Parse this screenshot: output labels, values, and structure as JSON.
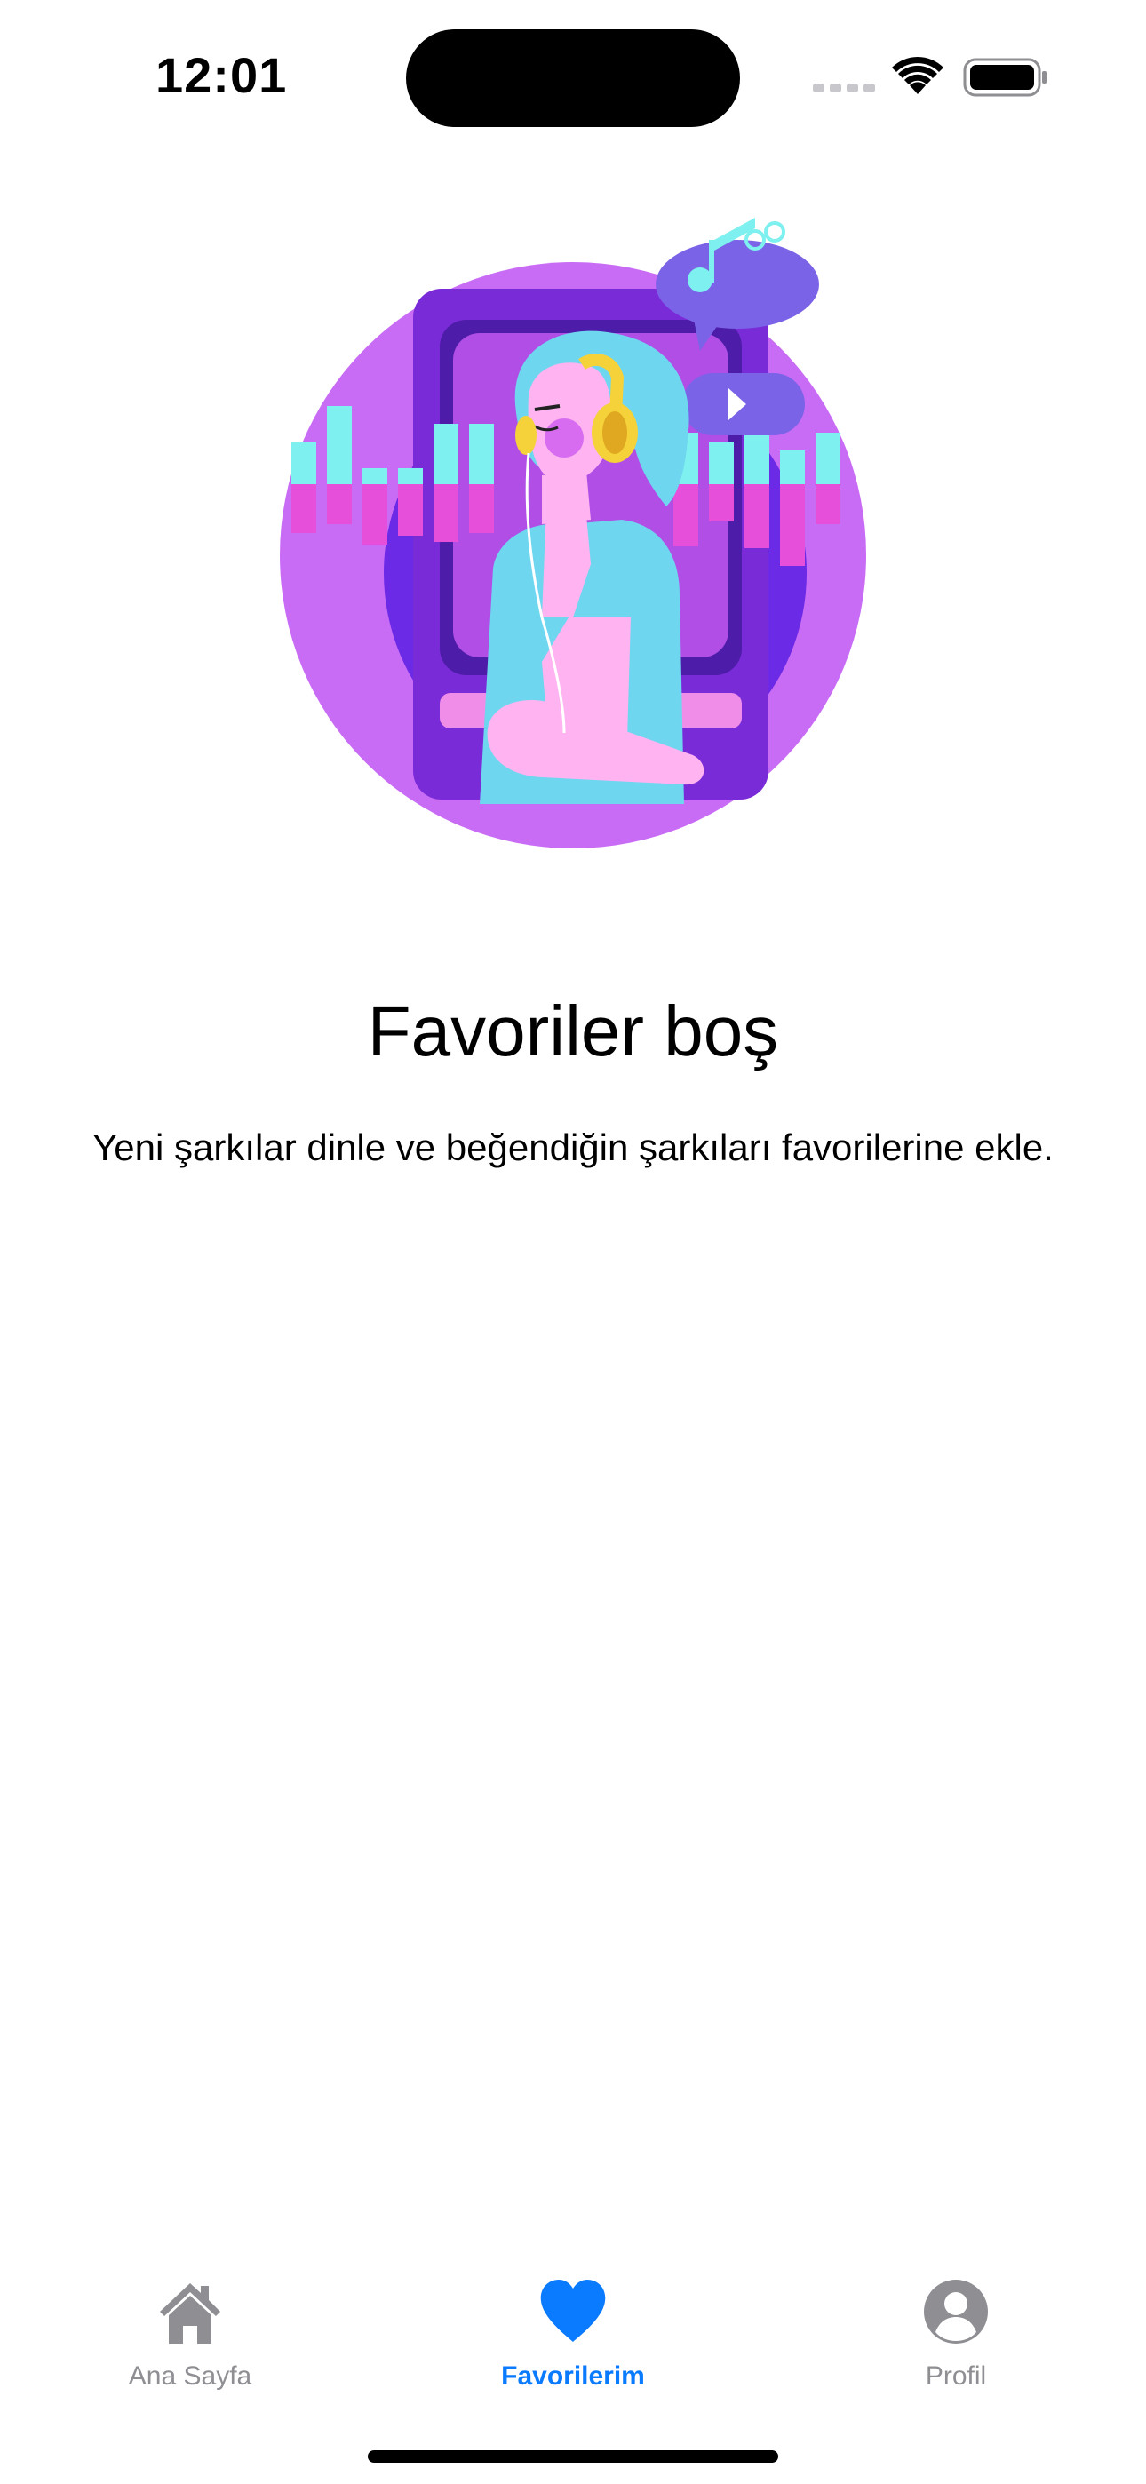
{
  "status_bar": {
    "time": "12:01"
  },
  "empty_state": {
    "title": "Favoriler boş",
    "subtitle": "Yeni şarkılar dinle ve beğendiğin şarkıları favorilerine ekle."
  },
  "tab_bar": {
    "items": [
      {
        "label": "Ana Sayfa",
        "icon": "house-icon",
        "active": false
      },
      {
        "label": "Favorilerim",
        "icon": "heart-icon",
        "active": true
      },
      {
        "label": "Profil",
        "icon": "person-circle-icon",
        "active": false
      }
    ],
    "active_color": "#0a7aff",
    "inactive_color": "#8e8e93"
  }
}
